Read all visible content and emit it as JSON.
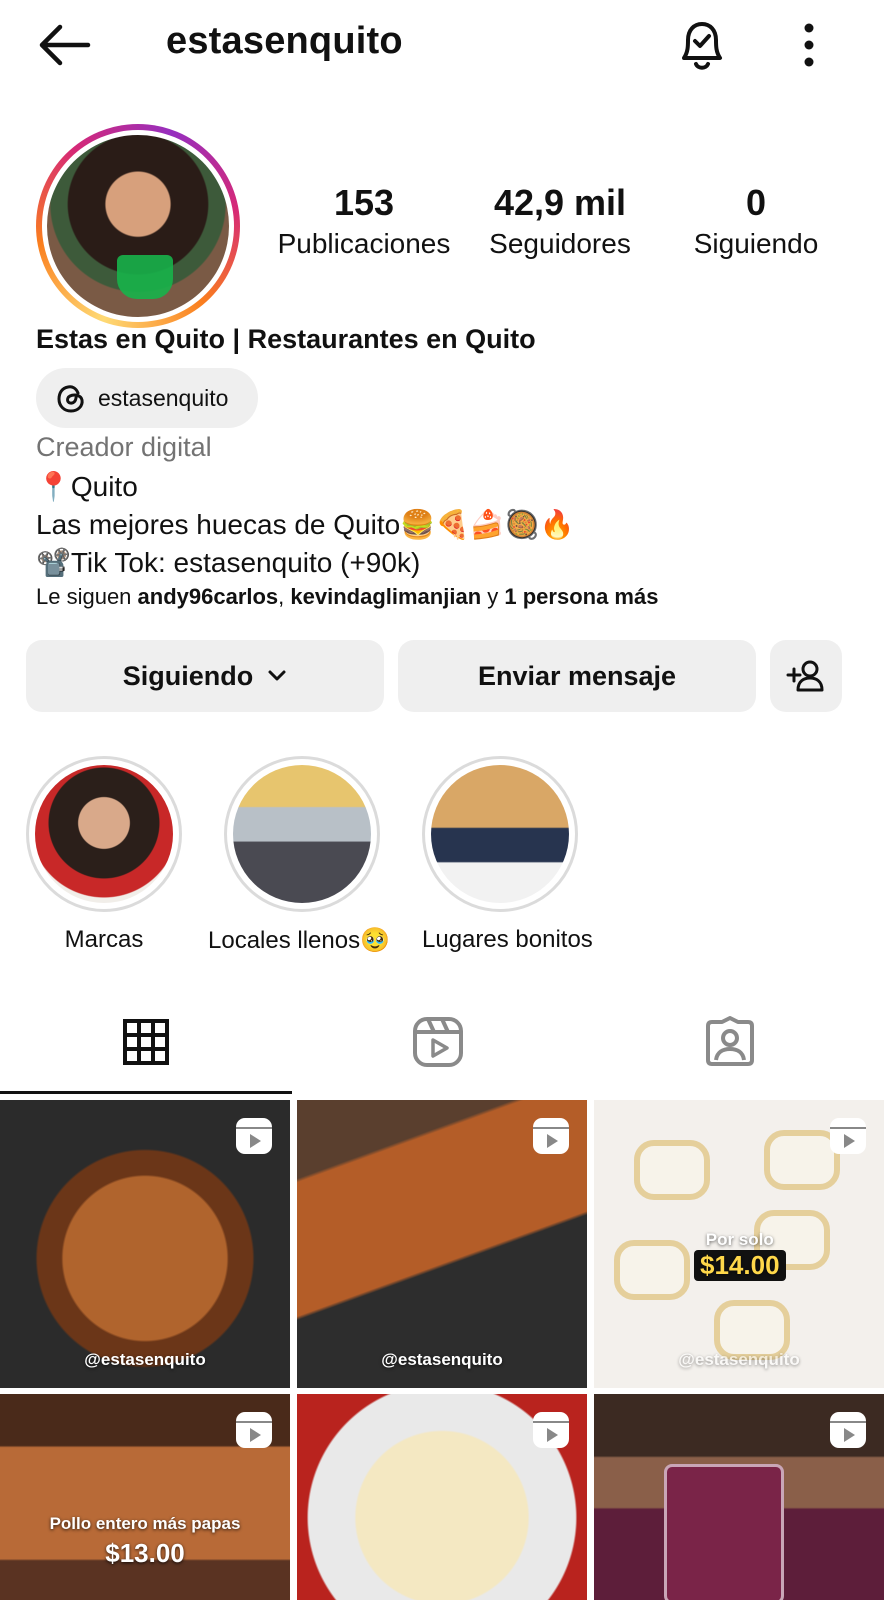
{
  "header": {
    "username": "estasenquito",
    "icons": {
      "back": "arrow-left-icon",
      "notifications": "bell-check-icon",
      "more": "more-vertical-icon"
    }
  },
  "profile": {
    "stats": [
      {
        "value": "153",
        "label": "Publicaciones"
      },
      {
        "value": "42,9 mil",
        "label": "Seguidores"
      },
      {
        "value": "0",
        "label": "Siguiendo"
      }
    ],
    "full_name": "Estas en Quito | Restaurantes en Quito",
    "threads_handle": "estasenquito",
    "category": "Creador digital",
    "bio": [
      "📍Quito",
      "Las mejores huecas de Quito🍔🍕🍰🥘🔥",
      "📽️Tik Tok: estasenquito (+90k)"
    ],
    "followed_by": {
      "prefix": "Le siguen ",
      "user1": "andy96carlos",
      "separator": ", ",
      "user2": "kevindaglimanjian",
      "middle": " y ",
      "more": "1 persona más"
    }
  },
  "actions": {
    "following_label": "Siguiendo",
    "message_label": "Enviar mensaje"
  },
  "highlights": [
    {
      "label": "Marcas"
    },
    {
      "label": "Locales llenos🥹"
    },
    {
      "label": "Lugares bonitos"
    }
  ],
  "tabs": [
    "grid-icon",
    "reels-icon",
    "tagged-icon"
  ],
  "posts": {
    "c1_watermark": "@estasenquito",
    "c2_watermark": "@estasenquito",
    "c3_watermark": "@estasenquito",
    "c3_price_small": "Por solo",
    "c3_price": "$14.00",
    "c4_caption": "Pollo entero más papas",
    "c4_price": "$13.00"
  },
  "colors": {
    "button_bg": "#efefef",
    "text": "#111111",
    "muted": "#737373"
  }
}
